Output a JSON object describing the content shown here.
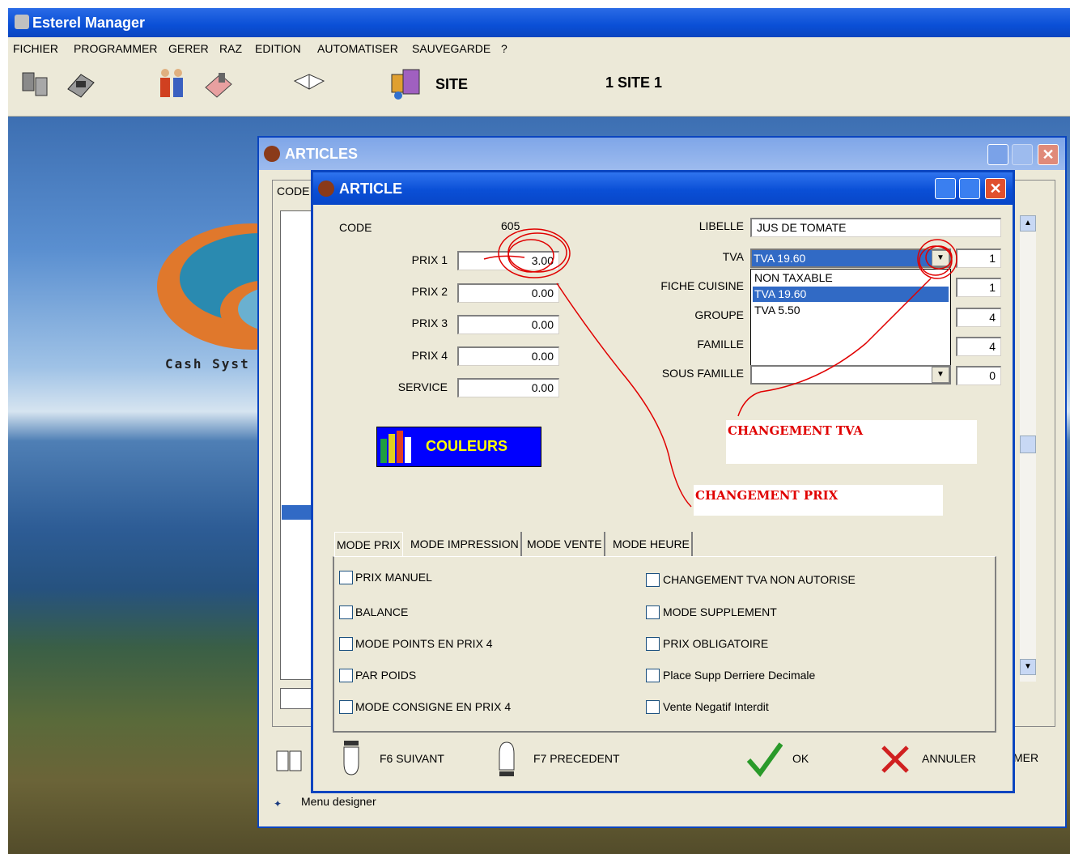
{
  "app": {
    "title": "Esterel Manager"
  },
  "menu": [
    "FICHIER",
    "PROGRAMMER",
    "GERER",
    "RAZ",
    "EDITION",
    "AUTOMATISER",
    "SAUVEGARDE",
    "?"
  ],
  "toolbar": {
    "site_label": "SITE",
    "current_site": "1 SITE 1"
  },
  "background": {
    "logo_text": "Cash Syst"
  },
  "articles_window": {
    "title": "ARTICLES",
    "column_code": "CODE",
    "footer_button_partial": "MER",
    "status_text": "Menu designer"
  },
  "article_dialog": {
    "title": "ARTICLE",
    "code_label": "CODE",
    "code_value": "605",
    "prices": [
      {
        "label": "PRIX 1",
        "value": "3.00"
      },
      {
        "label": "PRIX 2",
        "value": "0.00"
      },
      {
        "label": "PRIX 3",
        "value": "0.00"
      },
      {
        "label": "PRIX 4",
        "value": "0.00"
      },
      {
        "label": "SERVICE",
        "value": "0.00"
      }
    ],
    "libelle_label": "LIBELLE",
    "libelle_value": "JUS DE TOMATE",
    "tva_label": "TVA",
    "tva_selected": "TVA 19.60",
    "tva_code": "1",
    "tva_options": [
      "NON TAXABLE",
      "TVA 19.60",
      "TVA 5.50"
    ],
    "fiche_cuisine_label": "FICHE CUISINE",
    "fiche_cuisine_code": "1",
    "groupe_label": "GROUPE",
    "groupe_code": "4",
    "famille_label": "FAMILLE",
    "famille_code": "4",
    "sous_famille_label": "SOUS FAMILLE",
    "sous_famille_code": "0",
    "couleurs_label": "COULEURS",
    "tabs": [
      "MODE PRIX",
      "MODE IMPRESSION",
      "MODE VENTE",
      "MODE HEURE"
    ],
    "options_left": [
      "PRIX MANUEL",
      "BALANCE",
      "MODE POINTS EN PRIX 4",
      "PAR POIDS",
      "MODE CONSIGNE EN PRIX 4"
    ],
    "options_right": [
      "CHANGEMENT TVA NON AUTORISE",
      "MODE SUPPLEMENT",
      "PRIX OBLIGATOIRE",
      "Place Supp Derriere Decimale",
      "Vente Negatif Interdit"
    ],
    "buttons": {
      "next": "F6 SUIVANT",
      "prev": "F7 PRECEDENT",
      "ok": "OK",
      "cancel": "ANNULER"
    }
  },
  "annotations": {
    "tva": "CHANGEMENT TVA",
    "prix": "CHANGEMENT PRIX"
  },
  "colors": {
    "titlebar": "#0a4fd6",
    "window_bg": "#ece9d8",
    "selection": "#316ac5",
    "annotation": "#e00000",
    "couleurs_bg": "#0000ff",
    "couleurs_text": "#ffff00"
  }
}
